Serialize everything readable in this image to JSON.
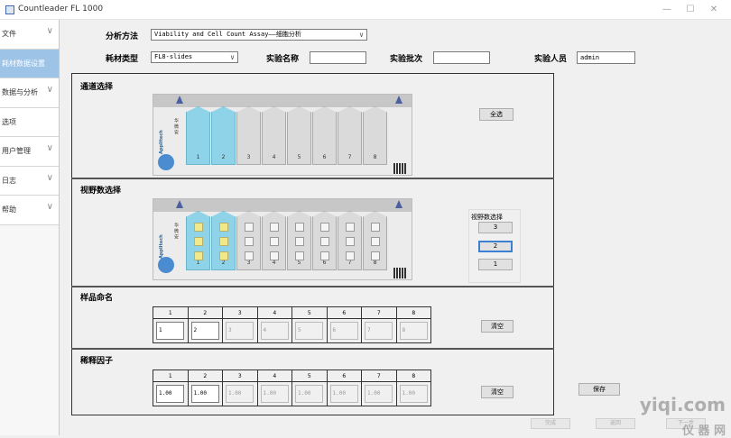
{
  "window": {
    "title": "Countleader FL 1000",
    "minimize": "—",
    "maximize": "☐",
    "close": "✕"
  },
  "sidebar": {
    "items": [
      {
        "label": "文件",
        "chevron": "∨"
      },
      {
        "label": "耗材数据设置",
        "chevron": ""
      },
      {
        "label": "数据与分析",
        "chevron": "∨"
      },
      {
        "label": "选项",
        "chevron": ""
      },
      {
        "label": "用户管理",
        "chevron": "∨"
      },
      {
        "label": "日志",
        "chevron": "∨"
      },
      {
        "label": "帮助",
        "chevron": "∨"
      }
    ],
    "active_index": 1
  },
  "form": {
    "method_label": "分析方法",
    "method_value": "Viability and Cell Count Assay——细胞分析",
    "consumable_label": "耗材类型",
    "consumable_value": "FL8-slides",
    "exp_name_label": "实验名称",
    "exp_name_value": "",
    "batch_label": "实验批次",
    "batch_value": "",
    "operator_label": "实验人员",
    "operator_value": "admin"
  },
  "channel_section": {
    "title": "通道选择",
    "select_all": "全选",
    "channels": [
      "1",
      "2",
      "3",
      "4",
      "5",
      "6",
      "7",
      "8"
    ],
    "selected": [
      true,
      true,
      false,
      false,
      false,
      false,
      false,
      false
    ],
    "brand": "Applitech",
    "flag_text": "华 微 安"
  },
  "field_section": {
    "title": "视野数选择",
    "panel_caption": "视野数选择",
    "options": [
      "3",
      "2",
      "1"
    ],
    "selected_option": "2"
  },
  "naming_section": {
    "title": "样品命名",
    "headers": [
      "1",
      "2",
      "3",
      "4",
      "5",
      "6",
      "7",
      "8"
    ],
    "values": [
      "1",
      "2",
      "3",
      "4",
      "5",
      "6",
      "7",
      "8"
    ],
    "enabled": [
      true,
      true,
      false,
      false,
      false,
      false,
      false,
      false
    ],
    "clear": "清空"
  },
  "dilution_section": {
    "title": "稀释因子",
    "headers": [
      "1",
      "2",
      "3",
      "4",
      "5",
      "6",
      "7",
      "8"
    ],
    "values": [
      "1.00",
      "1.00",
      "1.00",
      "1.00",
      "1.00",
      "1.00",
      "1.00",
      "1.00"
    ],
    "enabled": [
      true,
      true,
      false,
      false,
      false,
      false,
      false,
      false
    ],
    "clear": "清空"
  },
  "actions": {
    "save": "保存",
    "prev": "返回",
    "next": "下一步",
    "finish": "完成"
  },
  "watermark": {
    "main": "yiqi.com",
    "sub": "仪 器 网"
  }
}
